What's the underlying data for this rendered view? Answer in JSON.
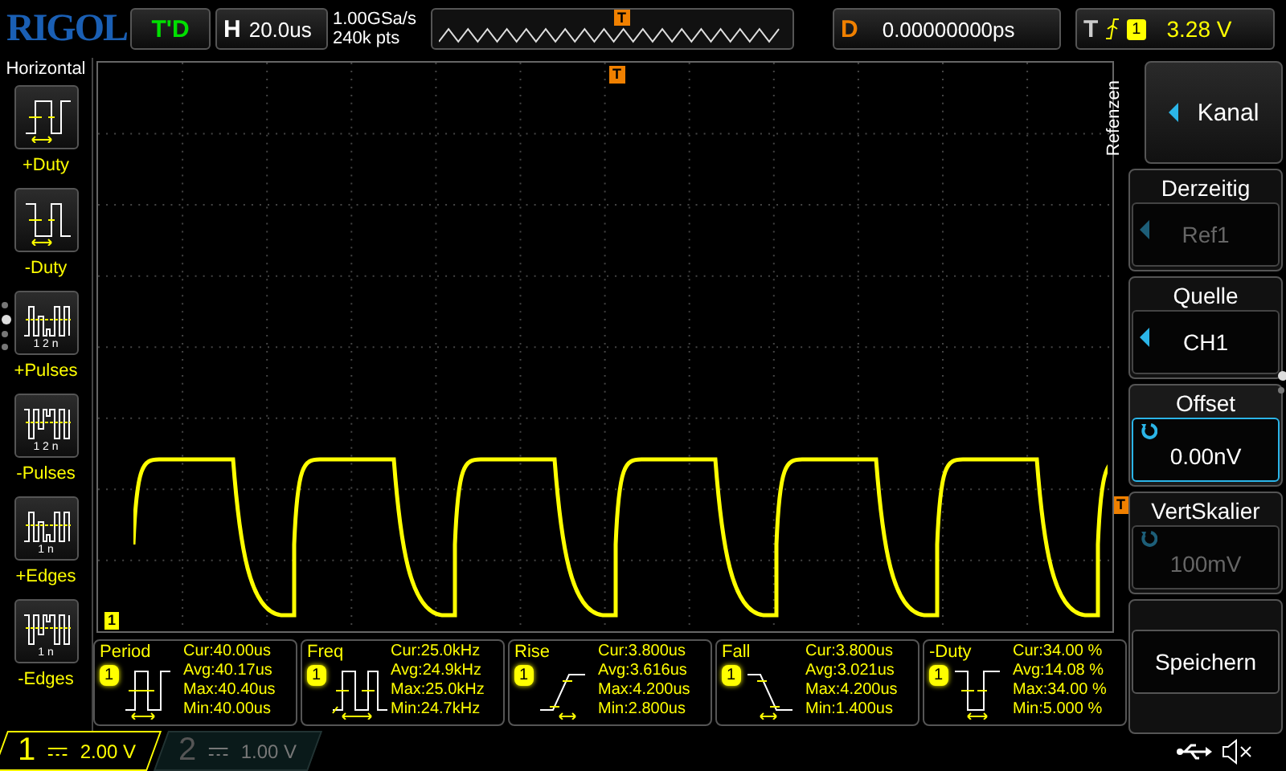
{
  "brand": "RIGOL",
  "run_state": "T'D",
  "timebase": {
    "label": "H",
    "value": "20.0us"
  },
  "acquisition": {
    "sample_rate": "1.00GSa/s",
    "memory_depth": "240k pts"
  },
  "overview": {
    "marker": "T"
  },
  "delay": {
    "label": "D",
    "value": "0.00000000ps"
  },
  "trigger": {
    "label": "T",
    "source": "1",
    "level": "3.28 V"
  },
  "left_menu": {
    "title": "Horizontal",
    "items": [
      {
        "kind": "pduty",
        "label": "+Duty"
      },
      {
        "kind": "nduty",
        "label": "-Duty"
      },
      {
        "kind": "ppulses",
        "label": "+Pulses",
        "caption": "1 2 n"
      },
      {
        "kind": "npulses",
        "label": "-Pulses",
        "caption": "1 2 n"
      },
      {
        "kind": "pedges",
        "label": "+Edges",
        "caption": "1 n"
      },
      {
        "kind": "nedges",
        "label": "-Edges",
        "caption": "1 n"
      }
    ],
    "pages": [
      {
        "selected": false
      },
      {
        "selected": true
      },
      {
        "selected": false
      },
      {
        "selected": false
      }
    ]
  },
  "screen": {
    "trigger_marker": "T",
    "level_marker": "T",
    "channel_marker": "1"
  },
  "measurements": [
    {
      "kind": "period",
      "name": "Period",
      "source": "1",
      "lines": [
        "Cur:40.00us",
        "Avg:40.17us",
        "Max:40.40us",
        "Min:40.00us"
      ]
    },
    {
      "kind": "freq",
      "name": "Freq",
      "source": "1",
      "lines": [
        "Cur:25.0kHz",
        "Avg:24.9kHz",
        "Max:25.0kHz",
        "Min:24.7kHz"
      ]
    },
    {
      "kind": "rise",
      "name": "Rise",
      "source": "1",
      "lines": [
        "Cur:3.800us",
        "Avg:3.616us",
        "Max:4.200us",
        "Min:2.800us"
      ]
    },
    {
      "kind": "fall",
      "name": "Fall",
      "source": "1",
      "lines": [
        "Cur:3.800us",
        "Avg:3.021us",
        "Max:4.200us",
        "Min:1.400us"
      ]
    },
    {
      "kind": "nduty",
      "name": "-Duty",
      "source": "1",
      "lines": [
        "Cur:34.00 %",
        "Avg:14.08 %",
        "Max:34.00 %",
        "Min:5.000 %"
      ]
    }
  ],
  "right_menu": {
    "side_label": "Refenzen",
    "items": [
      {
        "kind": "selector",
        "label": "Kanal"
      },
      {
        "kind": "choice",
        "title": "Derzeitig",
        "value": "Ref1",
        "disabled": true,
        "selected": false
      },
      {
        "kind": "choice",
        "title": "Quelle",
        "value": "CH1",
        "disabled": false,
        "selected": false
      },
      {
        "kind": "knob",
        "title": "Offset",
        "value": "0.00nV",
        "disabled": false,
        "selected": true
      },
      {
        "kind": "knob",
        "title": "VertSkalier",
        "value": "100mV",
        "disabled": true,
        "selected": false
      },
      {
        "kind": "action",
        "label": "Speichern"
      }
    ],
    "pages": [
      {
        "selected": true
      },
      {
        "selected": false
      }
    ]
  },
  "channels": [
    {
      "number": "1",
      "scale": "2.00 V",
      "on": true
    },
    {
      "number": "2",
      "scale": "1.00 V",
      "on": false
    }
  ]
}
